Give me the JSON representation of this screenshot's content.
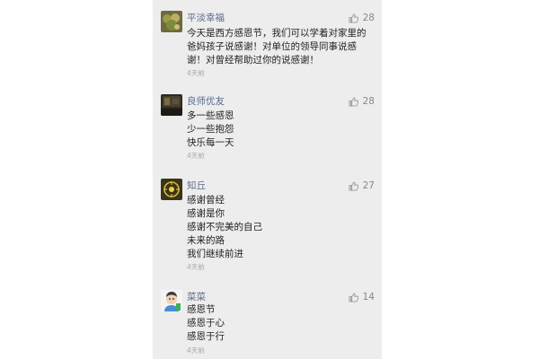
{
  "like_icon": "thumbs-up-icon",
  "colors": {
    "username": "#5b6b8c",
    "text": "#222222",
    "meta": "#a9a9a9",
    "panel_bg": "#ededed"
  },
  "comments": [
    {
      "username": "平淡幸福",
      "likes": "28",
      "lines": [
        "今天是西方感恩节，我们可以学着对家里的",
        "爸妈孩子说感谢！对单位的领导同事说感",
        "谢！对曾经帮助过你的说感谢！"
      ],
      "time": "4天前"
    },
    {
      "username": "良师优友",
      "likes": "28",
      "lines": [
        "多一些感恩",
        "少一些抱怨",
        "快乐每一天"
      ],
      "time": "4天前"
    },
    {
      "username": "知丘",
      "likes": "27",
      "lines": [
        "感谢曾经",
        "感谢是你",
        "感谢不完美的自己",
        "未来的路",
        "我们继续前进"
      ],
      "time": "4天前"
    },
    {
      "username": "菜菜",
      "likes": "14",
      "lines": [
        "感恩节",
        "感恩于心",
        "感恩于行"
      ],
      "time": "4天前"
    }
  ]
}
